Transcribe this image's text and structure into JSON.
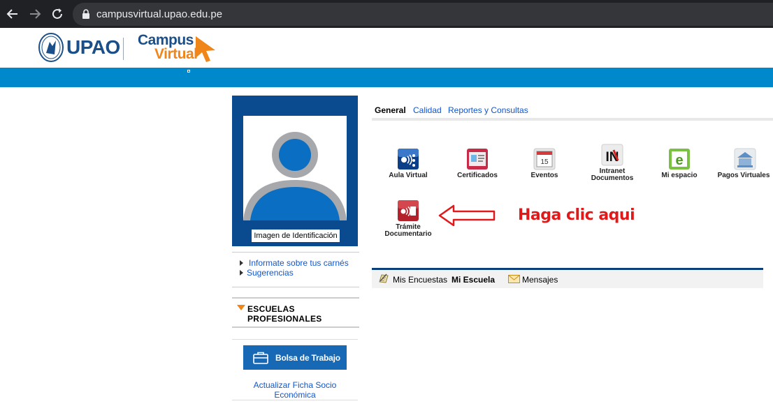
{
  "browser": {
    "url": "campusvirtual.upao.edu.pe"
  },
  "header": {
    "upao_text": "UPAO",
    "campus_word": "Campus",
    "virtual_word": "Virtual"
  },
  "profile": {
    "id_label": "Imagen de Identificación"
  },
  "side_links": [
    {
      "label": "Informate sobre tus carnés"
    },
    {
      "label": "Sugerencias"
    }
  ],
  "escuelas": {
    "label": "ESCUELAS PROFESIONALES"
  },
  "bolsa": {
    "label": "Bolsa de Trabajo"
  },
  "ficha": {
    "label": "Actualizar Ficha Socio Económica"
  },
  "tabs": [
    {
      "label": "General",
      "active": true
    },
    {
      "label": "Calidad",
      "active": false
    },
    {
      "label": "Reportes y Consultas",
      "active": false
    }
  ],
  "apps": [
    {
      "label": "Aula Virtual",
      "icon": "aula-virtual-icon"
    },
    {
      "label": "Certificados",
      "icon": "certificados-icon"
    },
    {
      "label": "Eventos",
      "icon": "calendar-icon",
      "icon_text": "15"
    },
    {
      "label": "Intranet Documentos",
      "icon": "intranet-icon",
      "icon_text": "IN"
    },
    {
      "label": "Mi espacio",
      "icon": "mi-espacio-icon",
      "icon_text": "e"
    },
    {
      "label": "Pagos Virtuales",
      "icon": "pagos-virtuales-icon"
    },
    {
      "label": "Trámite Documentario",
      "icon": "tramite-icon"
    }
  ],
  "annotation": {
    "text": "Haga clic aqui",
    "color": "#e01a1a"
  },
  "bottom_bar": {
    "encuestas": "Mis Encuestas",
    "escuela": "Mi Escuela",
    "mensajes": "Mensajes"
  },
  "colors": {
    "brand_blue": "#1b4f8a",
    "brand_orange": "#f08519",
    "band_blue": "#0088cc",
    "profile_blue": "#0a4a8f"
  }
}
